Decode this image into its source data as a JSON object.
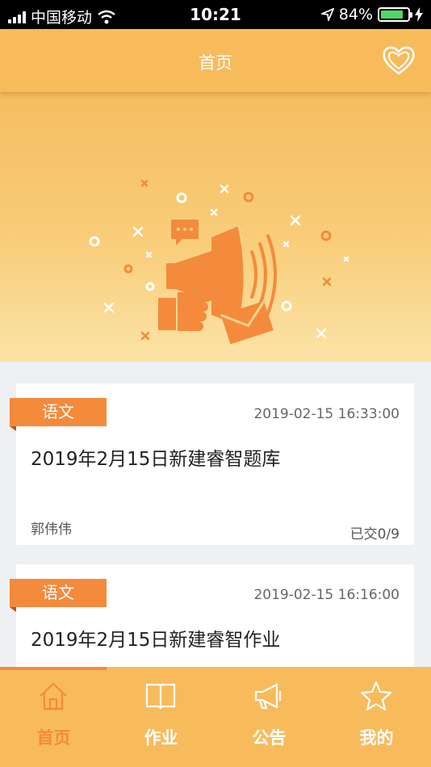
{
  "status_bar": {
    "carrier": "中国移动",
    "time": "10:21",
    "battery": "84%",
    "battery_level": 0.84,
    "icons": [
      "signal-icon",
      "wifi-icon",
      "location-icon",
      "battery-icon",
      "charging-icon"
    ]
  },
  "nav": {
    "title": "首页",
    "right_icon": "heart-icon"
  },
  "banner": {
    "illustration": "megaphone-announcement-illustration"
  },
  "cards": [
    {
      "tag": "语文",
      "time": "2019-02-15 16:33:00",
      "title": "2019年2月15日新建睿智题库",
      "author": "郭伟伟",
      "status": "已交0/9"
    },
    {
      "tag": "语文",
      "time": "2019-02-15 16:16:00",
      "title": "2019年2月15日新建睿智作业"
    }
  ],
  "tabs": [
    {
      "label": "首页",
      "icon": "home-icon",
      "active": true
    },
    {
      "label": "作业",
      "icon": "book-icon",
      "active": false
    },
    {
      "label": "公告",
      "icon": "megaphone-icon",
      "active": false
    },
    {
      "label": "我的",
      "icon": "star-icon",
      "active": false
    }
  ],
  "colors": {
    "primary": "#f7bb5c",
    "accent": "#f48a3c",
    "background": "#eef0f3"
  }
}
